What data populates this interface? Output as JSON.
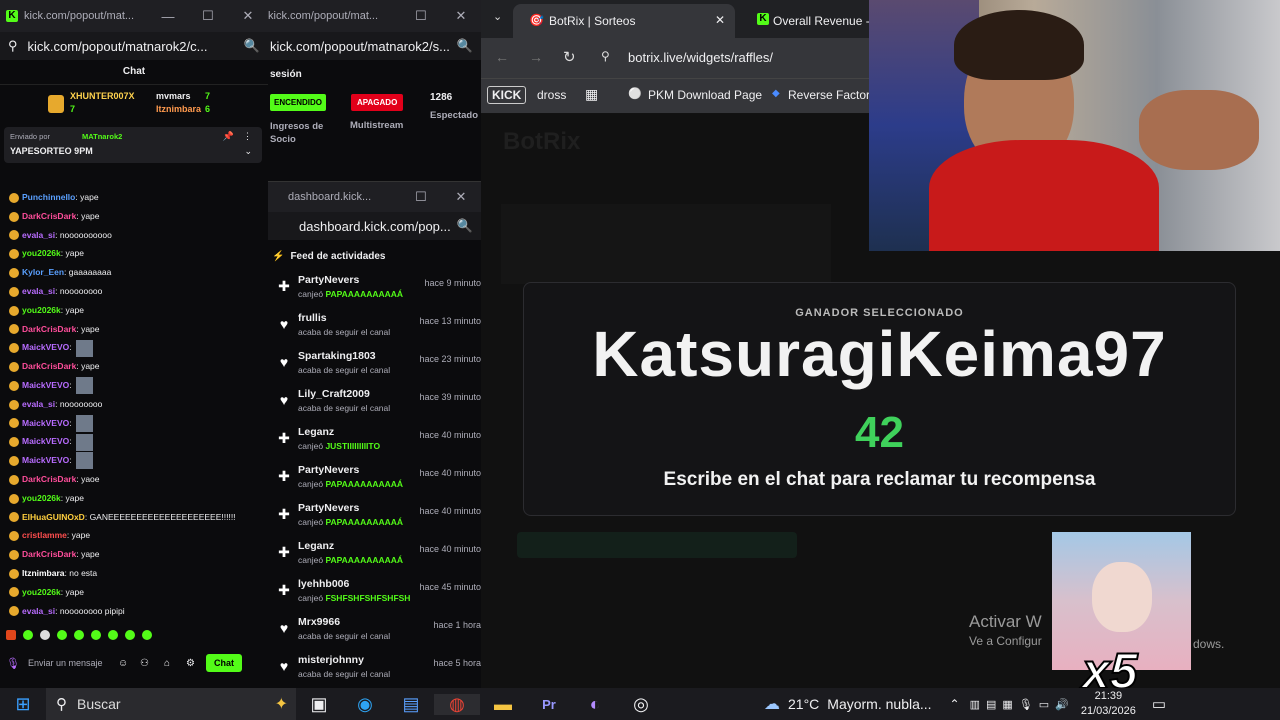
{
  "chat_window": {
    "tab_title": "kick.com/popout/mat...",
    "url": "kick.com/popout/matnarok2/c...",
    "header": "Chat",
    "top_gifters": [
      {
        "name": "XHUNTER007X",
        "count": "7"
      },
      {
        "name": "mvmars",
        "count": "7"
      },
      {
        "name": "Itznimbara",
        "count": "6"
      }
    ],
    "pinned": {
      "sent_by": "Enviado por",
      "author": "MATnarok2",
      "text": "YAPESORTEO 9PM"
    },
    "messages": [
      {
        "user": "Punchinnello",
        "color": "#5aa0ff",
        "text": "yape",
        "emotes": 0
      },
      {
        "user": "DarkCrisDark",
        "color": "#ff4e9b",
        "text": "yape",
        "emotes": 0
      },
      {
        "user": "evala_si",
        "color": "#b86cff",
        "text": "noooooooooo",
        "emotes": 0
      },
      {
        "user": "you2026k",
        "color": "#53fc18",
        "text": "yape",
        "emotes": 0
      },
      {
        "user": "Kylor_Een",
        "color": "#5aa0ff",
        "text": "gaaaaaaaa",
        "emotes": 0
      },
      {
        "user": "evala_si",
        "color": "#b86cff",
        "text": "noooooooo",
        "emotes": 0
      },
      {
        "user": "you2026k",
        "color": "#53fc18",
        "text": "yape",
        "emotes": 0
      },
      {
        "user": "DarkCrisDark",
        "color": "#ff4e9b",
        "text": "yape",
        "emotes": 0
      },
      {
        "user": "MaickVEVO",
        "color": "#b86cff",
        "text": "",
        "emotes": 1
      },
      {
        "user": "DarkCrisDark",
        "color": "#ff4e9b",
        "text": "yape",
        "emotes": 0
      },
      {
        "user": "MaickVEVO",
        "color": "#b86cff",
        "text": "",
        "emotes": 1
      },
      {
        "user": "evala_si",
        "color": "#b86cff",
        "text": "noooooooo",
        "emotes": 0
      },
      {
        "user": "MaickVEVO",
        "color": "#b86cff",
        "text": "",
        "emotes": 1
      },
      {
        "user": "MaickVEVO",
        "color": "#b86cff",
        "text": "",
        "emotes": 1
      },
      {
        "user": "MaickVEVO",
        "color": "#b86cff",
        "text": "",
        "emotes": 1
      },
      {
        "user": "DarkCrisDark",
        "color": "#ff4e9b",
        "text": "yaoe",
        "emotes": 0
      },
      {
        "user": "you2026k",
        "color": "#53fc18",
        "text": "yape",
        "emotes": 0
      },
      {
        "user": "ElHuaGUINOxD",
        "color": "#ffcf3e",
        "text": "GANEEEEEEEEEEEEEEEEEEEE!!!!!!",
        "emotes": 0
      },
      {
        "user": "cristlamme",
        "color": "#ff4e4e",
        "text": "yape",
        "emotes": 0
      },
      {
        "user": "DarkCrisDark",
        "color": "#ff4e9b",
        "text": "yape",
        "emotes": 0
      },
      {
        "user": "Itznimbara",
        "color": "#ffffff",
        "text": "no esta",
        "emotes": 0
      },
      {
        "user": "you2026k",
        "color": "#53fc18",
        "text": "yape",
        "emotes": 0
      },
      {
        "user": "evala_si",
        "color": "#b86cff",
        "text": "noooooooo pipipi",
        "emotes": 0
      }
    ],
    "input_placeholder": "Enviar un mensaje",
    "chat_button": "Chat"
  },
  "dashboard_window": {
    "tab_title": "kick.com/popout/mat...",
    "url": "kick.com/popout/matnarok2/s...",
    "section": "sesión",
    "stats": [
      {
        "badge": "ENCENDIDO",
        "badge_color": "#53fc18",
        "label": "Ingresos de Socio"
      },
      {
        "badge": "APAGADO",
        "badge_color": "#e2001a",
        "label": "Multistream"
      },
      {
        "badge": "1286",
        "badge_color": "",
        "label": "Espectado"
      }
    ]
  },
  "feed_window": {
    "tab_title": "dashboard.kick...",
    "url": "dashboard.kick.com/pop...",
    "header": "Feed de actividades",
    "items": [
      {
        "icon": "gift",
        "name": "PartyNevers",
        "prefix": "canjeó",
        "highlight": "PAPAAAAAAAAAÁ",
        "time": "hace 9 minuto"
      },
      {
        "icon": "heart",
        "name": "frullis",
        "prefix": "acaba de seguir el canal",
        "highlight": "",
        "time": "hace 13 minuto"
      },
      {
        "icon": "heart",
        "name": "Spartaking1803",
        "prefix": "acaba de seguir el canal",
        "highlight": "",
        "time": "hace 23 minuto"
      },
      {
        "icon": "heart",
        "name": "Lily_Craft2009",
        "prefix": "acaba de seguir el canal",
        "highlight": "",
        "time": "hace 39 minuto"
      },
      {
        "icon": "gift",
        "name": "Leganz",
        "prefix": "canjeó",
        "highlight": "JUSTIIIIIIIIITO",
        "time": "hace 40 minuto"
      },
      {
        "icon": "gift",
        "name": "PartyNevers",
        "prefix": "canjeó",
        "highlight": "PAPAAAAAAAAAÁ",
        "time": "hace 40 minuto"
      },
      {
        "icon": "gift",
        "name": "PartyNevers",
        "prefix": "canjeó",
        "highlight": "PAPAAAAAAAAAÁ",
        "time": "hace 40 minuto"
      },
      {
        "icon": "gift",
        "name": "Leganz",
        "prefix": "canjeó",
        "highlight": "PAPAAAAAAAAAÁ",
        "time": "hace 40 minuto"
      },
      {
        "icon": "gift",
        "name": "lyehhb006",
        "prefix": "canjeó",
        "highlight": "FSHFSHFSHFSHFSH",
        "time": "hace 45 minuto"
      },
      {
        "icon": "heart",
        "name": "Mrx9966",
        "prefix": "acaba de seguir el canal",
        "highlight": "",
        "time": "hace 1 hora"
      },
      {
        "icon": "heart",
        "name": "misterjohnny",
        "prefix": "acaba de seguir el canal",
        "highlight": "",
        "time": "hace 5 hora"
      }
    ]
  },
  "browser": {
    "tabs": [
      {
        "title": "BotRix | Sorteos",
        "active": true
      },
      {
        "title": "Overall Revenue - K",
        "active": false
      }
    ],
    "url": "botrix.live/widgets/raffles/",
    "bookmarks": [
      "KICK",
      "dross",
      "PKM Download Page",
      "Reverse Factorin"
    ]
  },
  "raffle": {
    "bg_title": "BotRix",
    "label": "GANADOR SELECCIONADO",
    "winner": "KatsuragiKeima97",
    "number": "42",
    "instruction": "Escribe en el chat para reclamar tu recompensa",
    "accent": "#3fd15b"
  },
  "watermark": {
    "title": "Activar W",
    "subtitle": "Ve a Configur",
    "subtitle_end": "dows."
  },
  "overlay": {
    "multiplier": "x5"
  },
  "taskbar": {
    "search": "Buscar",
    "weather_temp": "21°C",
    "weather_text": "Mayorm. nubla...",
    "time": "21:39",
    "date": "21/03/2026"
  }
}
